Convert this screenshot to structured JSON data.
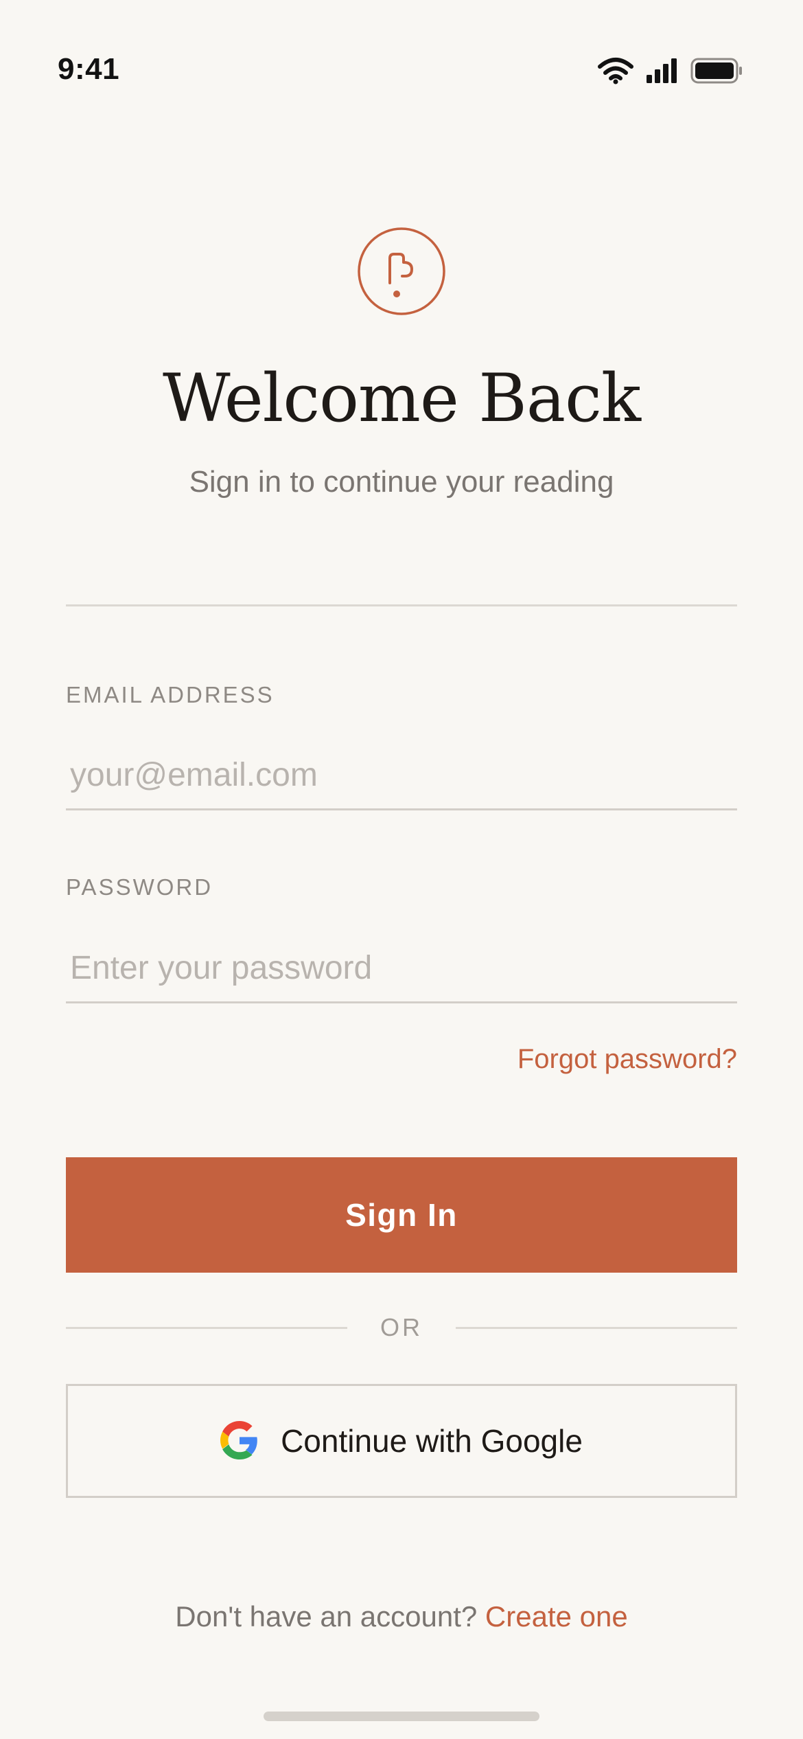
{
  "status_bar": {
    "time": "9:41",
    "icons": [
      "wifi-icon",
      "signal-icon",
      "battery-icon"
    ]
  },
  "header": {
    "logo_icon": "reading-app-logo-icon",
    "title": "Welcome Back",
    "subtitle": "Sign in to continue your reading"
  },
  "form": {
    "email": {
      "label": "EMAIL ADDRESS",
      "value": "",
      "placeholder": "your@email.com"
    },
    "password": {
      "label": "PASSWORD",
      "value": "",
      "placeholder": "Enter your password"
    },
    "forgot_label": "Forgot password?",
    "sign_in_label": "Sign In",
    "divider_label": "OR",
    "google_label": "Continue with Google",
    "google_icon": "google-icon"
  },
  "footer": {
    "prompt": "Don't have an account?",
    "link_label": "Create one"
  },
  "colors": {
    "background": "#F9F7F3",
    "accent": "#C4613F",
    "text_primary": "#1E1A17",
    "text_secondary": "#7A7571",
    "placeholder": "#B8B3AE",
    "divider": "#DCD8D2"
  }
}
